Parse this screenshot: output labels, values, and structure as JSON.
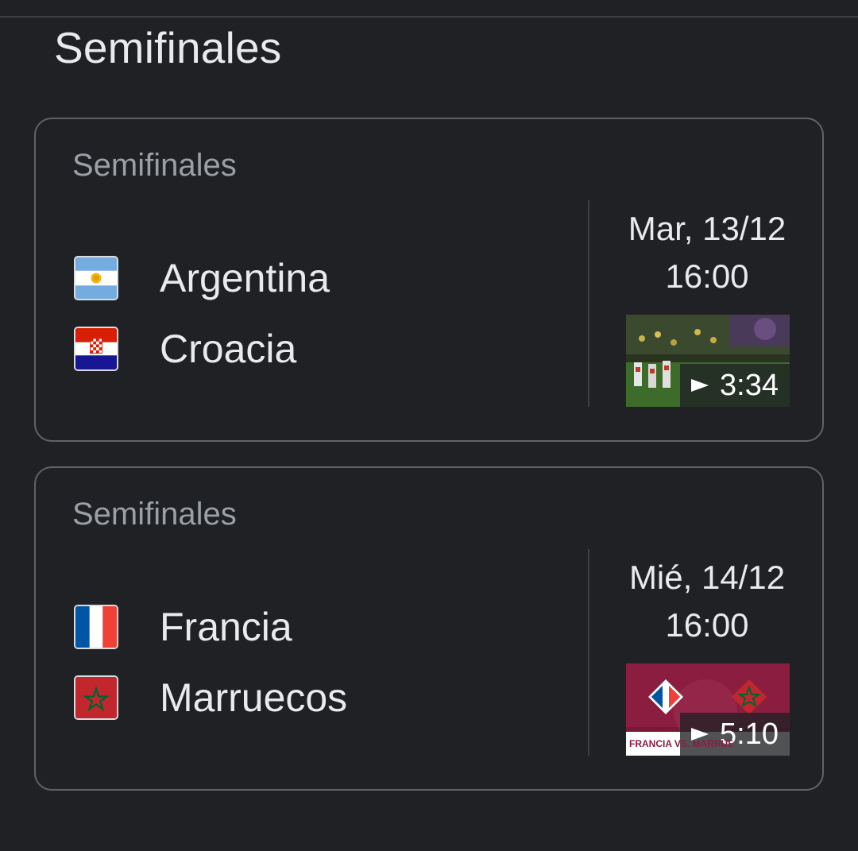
{
  "section_title": "Semifinales",
  "matches": [
    {
      "stage": "Semifinales",
      "team1": {
        "name": "Argentina",
        "flag": "argentina-flag"
      },
      "team2": {
        "name": "Croacia",
        "flag": "croatia-flag"
      },
      "date": "Mar, 13/12",
      "time": "16:00",
      "video": {
        "duration": "3:34",
        "icon": "play-icon"
      }
    },
    {
      "stage": "Semifinales",
      "team1": {
        "name": "Francia",
        "flag": "france-flag"
      },
      "team2": {
        "name": "Marruecos",
        "flag": "morocco-flag"
      },
      "date": "Mié, 14/12",
      "time": "16:00",
      "video": {
        "duration": "5:10",
        "icon": "play-icon",
        "overlay_text": "FRANCIA VS. MARRUECOS"
      }
    }
  ]
}
